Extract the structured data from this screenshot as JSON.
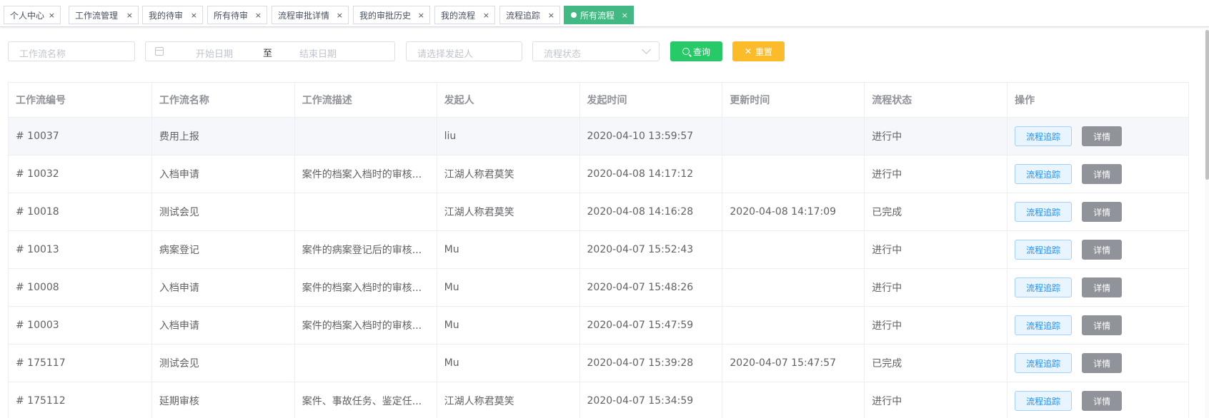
{
  "tabs": [
    {
      "label": "个人中心",
      "active": false
    },
    {
      "label": "工作流管理",
      "active": false
    },
    {
      "label": "我的待审",
      "active": false
    },
    {
      "label": "所有待审",
      "active": false
    },
    {
      "label": "流程审批详情",
      "active": false
    },
    {
      "label": "我的审批历史",
      "active": false
    },
    {
      "label": "我的流程",
      "active": false
    },
    {
      "label": "流程追踪",
      "active": false
    },
    {
      "label": "所有流程",
      "active": true
    }
  ],
  "tab_close_glyph": "×",
  "filters": {
    "name_placeholder": "工作流名称",
    "start_placeholder": "开始日期",
    "range_separator": "至",
    "end_placeholder": "结束日期",
    "initiator_placeholder": "请选择发起人",
    "status_placeholder": "流程状态",
    "query_label": "查询",
    "reset_label": "重置"
  },
  "table": {
    "headers": [
      "工作流编号",
      "工作流名称",
      "工作流描述",
      "发起人",
      "发起时间",
      "更新时间",
      "流程状态",
      "操作"
    ],
    "trace_label": "流程追踪",
    "detail_label": "详情",
    "rows": [
      {
        "id": "# 10037",
        "name": "费用上报",
        "desc": "",
        "initiator": "liu",
        "started": "2020-04-10 13:59:57",
        "updated": "",
        "status": "进行中"
      },
      {
        "id": "# 10032",
        "name": "入档申请",
        "desc": "案件的档案入档时的审核...",
        "initiator": "江湖人称君莫笑",
        "started": "2020-04-08 14:17:12",
        "updated": "",
        "status": "进行中"
      },
      {
        "id": "# 10018",
        "name": "测试会见",
        "desc": "",
        "initiator": "江湖人称君莫笑",
        "started": "2020-04-08 14:16:28",
        "updated": "2020-04-08 14:17:09",
        "status": "已完成"
      },
      {
        "id": "# 10013",
        "name": "病案登记",
        "desc": "案件的病案登记后的审核...",
        "initiator": "Mu",
        "started": "2020-04-07 15:52:43",
        "updated": "",
        "status": "进行中"
      },
      {
        "id": "# 10008",
        "name": "入档申请",
        "desc": "案件的档案入档时的审核...",
        "initiator": "Mu",
        "started": "2020-04-07 15:48:26",
        "updated": "",
        "status": "进行中"
      },
      {
        "id": "# 10003",
        "name": "入档申请",
        "desc": "案件的档案入档时的审核...",
        "initiator": "Mu",
        "started": "2020-04-07 15:47:59",
        "updated": "",
        "status": "进行中"
      },
      {
        "id": "# 175117",
        "name": "测试会见",
        "desc": "",
        "initiator": "Mu",
        "started": "2020-04-07 15:39:28",
        "updated": "2020-04-07 15:47:57",
        "status": "已完成"
      },
      {
        "id": "# 175112",
        "name": "延期审核",
        "desc": "案件、事故任务、鉴定任...",
        "initiator": "江湖人称君莫笑",
        "started": "2020-04-07 15:34:59",
        "updated": "",
        "status": "进行中"
      }
    ]
  },
  "colors": {
    "active_tab": "#42b983",
    "query_button": "#27c968",
    "reset_button": "#fbbb2b",
    "trace_button_text": "#1890ff",
    "detail_button": "#909399"
  }
}
